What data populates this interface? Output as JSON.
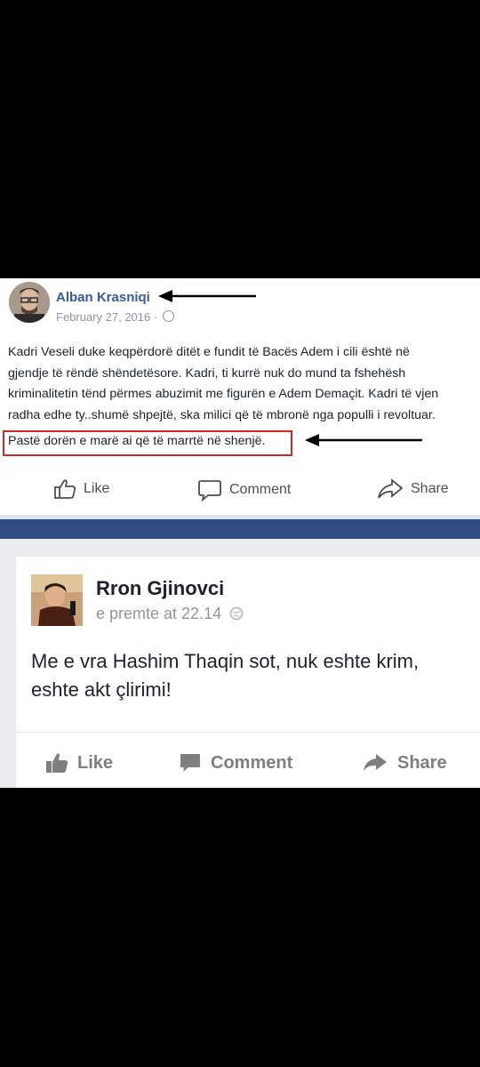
{
  "post1": {
    "author": "Alban Krasniqi",
    "date": "February 27, 2016 ·",
    "body_lines": [
      "Kadri Veseli duke keqpërdorë ditët e fundit të Bacës Adem i cili është në",
      "gjendje të rëndë shëndetësore. Kadri, ti kurrë nuk do mund ta fshehësh",
      "kriminalitetin tënd përmes abuzimit me figurën e Adem Demaçit. Kadri të vjen",
      "radha edhe ty..shumë shpejtë, ska milici që të mbronë nga populli i revoltuar."
    ],
    "highlighted_line": "Pastë dorën e marë ai që të marrtë në shenjë.",
    "actions": {
      "like": "Like",
      "comment": "Comment",
      "share": "Share"
    }
  },
  "post2": {
    "author": "Rron Gjinovci",
    "date": "e premte at 22.14",
    "body_lines": [
      "Me e vra Hashim Thaqin sot, nuk eshte krim,",
      "eshte akt çlirimi!"
    ],
    "actions": {
      "like": "Like",
      "comment": "Comment",
      "share": "Share"
    }
  },
  "colors": {
    "fb_blue": "#3b5998",
    "highlight_red": "#c92a2a",
    "header_strip": "#314d83"
  }
}
